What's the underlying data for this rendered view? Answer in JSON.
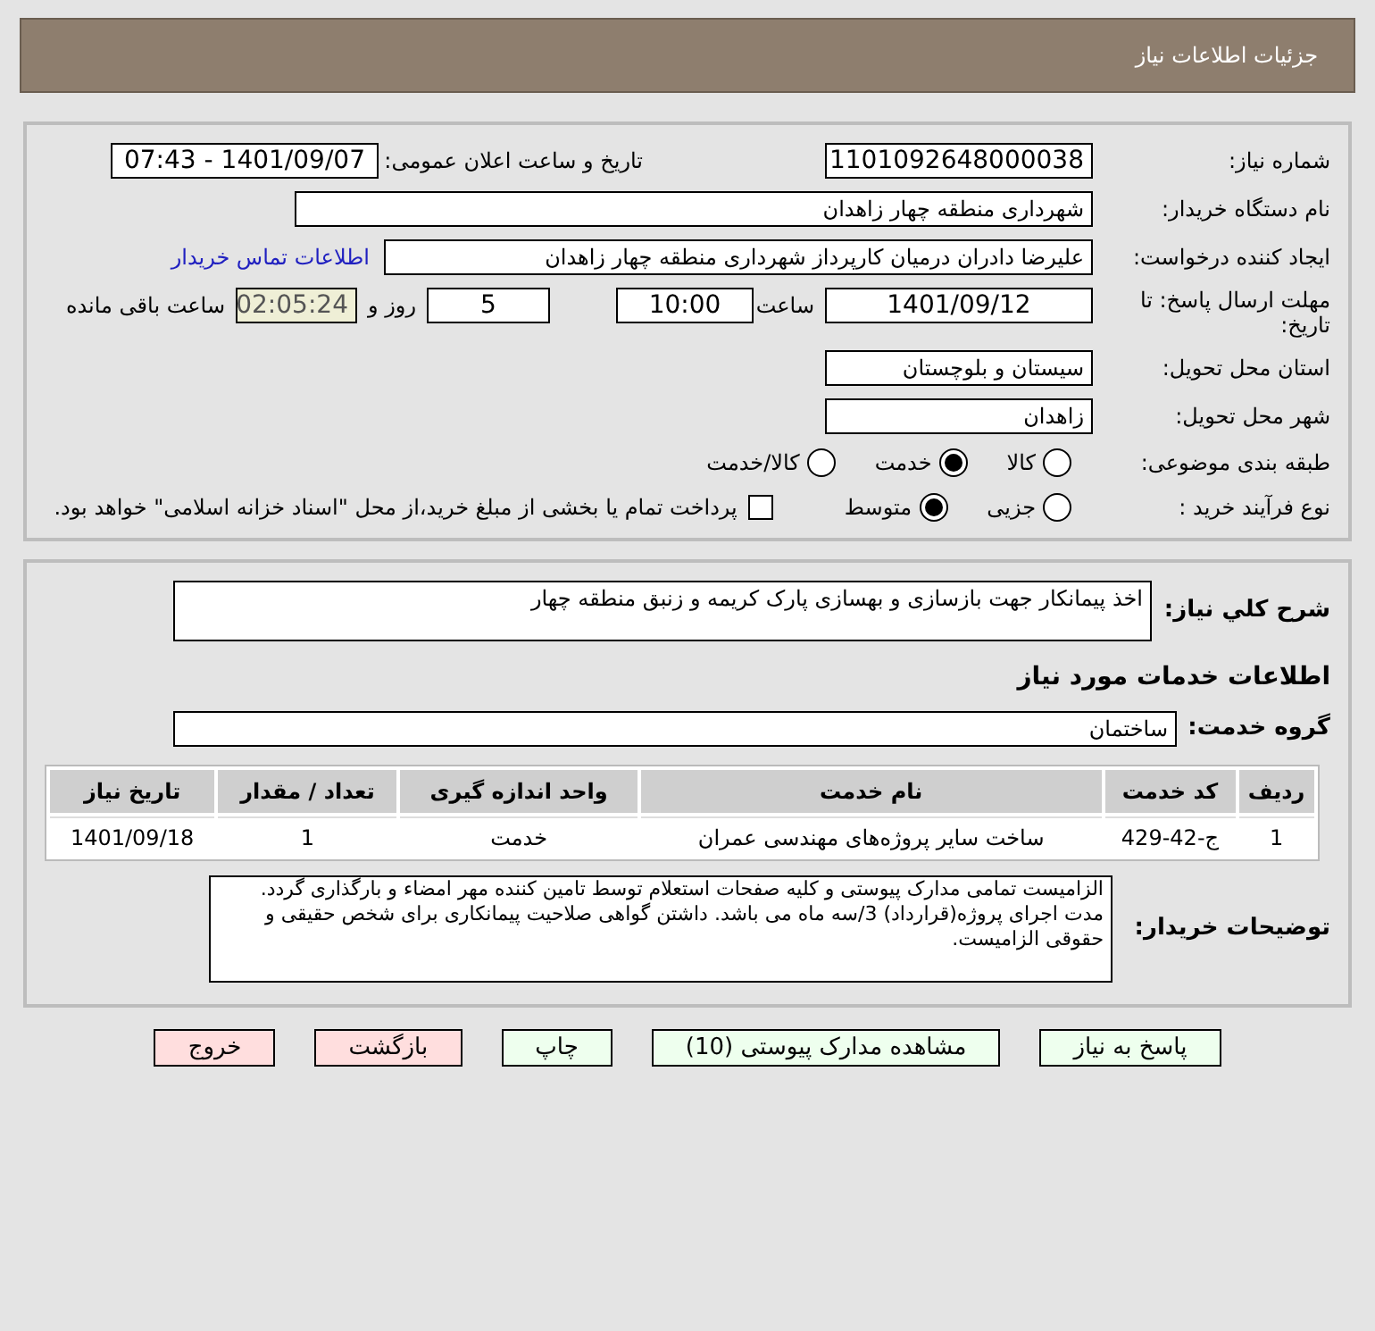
{
  "header": {
    "title": "جزئیات اطلاعات نیاز"
  },
  "need_number": {
    "label": "شماره نیاز:",
    "value": "1101092648000038"
  },
  "announce": {
    "label": "تاریخ و ساعت اعلان عمومی:",
    "value": "1401/09/07 - 07:43"
  },
  "buyer_org": {
    "label": "نام دستگاه خریدار:",
    "value": "شهرداری منطقه چهار زاهدان"
  },
  "requester": {
    "label": "ایجاد کننده درخواست:",
    "value": "علیرضا دادران درمیان کارپرداز شهرداری منطقه چهار زاهدان",
    "link": "اطلاعات تماس خریدار"
  },
  "deadline": {
    "label": "مهلت ارسال پاسخ: تا تاریخ:",
    "date": "1401/09/12",
    "time_label": "ساعت",
    "time": "10:00",
    "days": "5",
    "days_label": "روز و",
    "remaining": "02:05:24",
    "remaining_label": "ساعت باقی مانده"
  },
  "province": {
    "label": "استان محل تحویل:",
    "value": "سیستان و بلوچستان"
  },
  "city": {
    "label": "شهر محل تحویل:",
    "value": "زاهدان"
  },
  "category": {
    "label": "طبقه بندی موضوعی:",
    "options": [
      {
        "label": "کالا",
        "selected": false
      },
      {
        "label": "خدمت",
        "selected": true
      },
      {
        "label": "کالا/خدمت",
        "selected": false
      }
    ]
  },
  "process": {
    "label": "نوع فرآیند خرید :",
    "options": [
      {
        "label": "جزیی",
        "selected": false
      },
      {
        "label": "متوسط",
        "selected": true
      }
    ],
    "payment": {
      "label": "پرداخت تمام یا بخشی از مبلغ خرید،از محل \"اسناد خزانه اسلامی\" خواهد بود.",
      "checked": false
    }
  },
  "description": {
    "label": "شرح كلي نياز:",
    "value": "اخذ پیمانکار جهت بازسازی و بهسازی پارک کریمه و زنبق منطقه چهار"
  },
  "services_title": "اطلاعات خدمات مورد نیاز",
  "service_group": {
    "label": "گروه خدمت:",
    "value": "ساختمان"
  },
  "table": {
    "columns": [
      "ردیف",
      "کد خدمت",
      "نام خدمت",
      "واحد اندازه گیری",
      "تعداد / مقدار",
      "تاریخ نیاز"
    ],
    "rows": [
      [
        "1",
        "ج-42-429",
        "ساخت سایر پروژه‌های مهندسی عمران",
        "خدمت",
        "1",
        "1401/09/18"
      ]
    ]
  },
  "buyer_notes": {
    "label": "توضیحات خریدار:",
    "value": "الزامیست تمامی مدارک پیوستی و کلیه صفحات استعلام توسط تامین کننده مهر امضاء و بارگذاری گردد. مدت اجرای پروژه(قرارداد) 3/سه ماه می باشد. داشتن گواهی صلاحیت پیمانکاری برای شخص حقیقی و حقوقی الزامیست."
  },
  "buttons": [
    {
      "label": "پاسخ به نیاز",
      "kind": "normal"
    },
    {
      "label": "مشاهده مدارک پیوستی (10)",
      "kind": "normal"
    },
    {
      "label": "چاپ",
      "kind": "normal"
    },
    {
      "label": "بازگشت",
      "kind": "danger"
    },
    {
      "label": "خروج",
      "kind": "danger"
    }
  ]
}
